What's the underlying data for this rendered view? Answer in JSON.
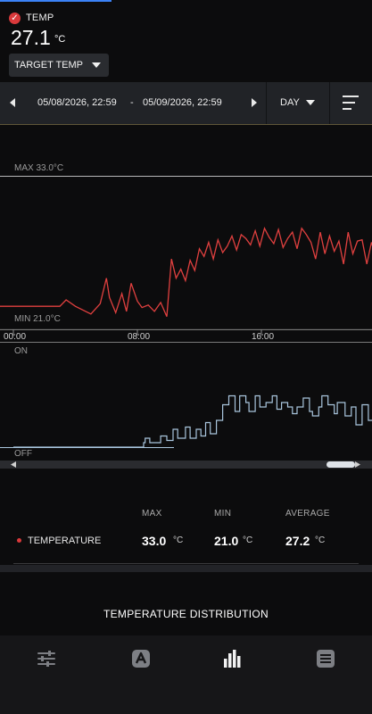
{
  "header": {
    "sensor_name": "TEMP",
    "status": "check-icon",
    "temperature": "27.1",
    "unit": "°C",
    "target_button_label": "TARGET TEMP"
  },
  "toolbar": {
    "range_start": "05/08/2026, 22:59",
    "range_separator": "-",
    "range_end": "05/09/2026, 22:59",
    "period": "DAY",
    "prev_icon": "caret-left-icon",
    "next_icon": "caret-right-icon",
    "filter_icon": "filter-lines-icon"
  },
  "chart_data": [
    {
      "type": "line",
      "x_ticks": [
        "00:00",
        "08:00",
        "16:00"
      ],
      "ylim": [
        21.0,
        33.0
      ],
      "max_label": "MAX 33.0°C",
      "min_label": "MIN 21.0°C",
      "color": "#e0403f",
      "x_hours": [
        0,
        1,
        2,
        3,
        3.4,
        4,
        5,
        5.6,
        6,
        6.2,
        6.6,
        7.0,
        7.3,
        7.6,
        8.0,
        8.3,
        8.7,
        9.1,
        9.5,
        9.9,
        10.2,
        10.5,
        10.8,
        11.1,
        11.4,
        11.7,
        12.0,
        12.3,
        12.6,
        12.9,
        13.2,
        13.5,
        13.8,
        14.1,
        14.4,
        14.7,
        15.0,
        15.3,
        15.6,
        15.9,
        16.2,
        16.5,
        16.8,
        17.1,
        17.4,
        17.7,
        18.0,
        18.3,
        18.6,
        18.9,
        19.2,
        19.5,
        19.8,
        20.1,
        20.4,
        20.7,
        21.0,
        21.3,
        21.6,
        21.9,
        22.2,
        22.5,
        22.8,
        23.1,
        23.4,
        23.7,
        24.0,
        24.2,
        24.5
      ],
      "values": [
        22.8,
        22.8,
        22.8,
        22.8,
        23.3,
        22.8,
        22.2,
        23.0,
        25.0,
        23.5,
        22.3,
        23.8,
        22.4,
        24.6,
        23.2,
        22.7,
        22.9,
        22.4,
        23.1,
        22.0,
        26.5,
        25.0,
        25.7,
        24.8,
        26.4,
        25.6,
        27.3,
        26.7,
        27.8,
        26.5,
        28.0,
        27.0,
        27.5,
        28.3,
        27.2,
        28.4,
        28.1,
        27.6,
        28.7,
        27.5,
        28.9,
        28.2,
        27.7,
        28.8,
        27.4,
        28.1,
        28.6,
        27.3,
        28.9,
        28.4,
        27.8,
        26.5,
        28.6,
        26.9,
        28.3,
        27.1,
        27.9,
        26.1,
        28.6,
        26.9,
        27.9,
        28.0,
        26.1,
        27.8,
        26.6,
        26.1,
        27.6,
        25.7,
        25.8
      ]
    },
    {
      "type": "line",
      "y_labels": [
        "ON",
        "OFF"
      ],
      "color": "#a9c5dd",
      "x_hours": [
        0,
        8.0,
        8.4,
        8.5,
        8.8,
        9.3,
        9.5,
        9.9,
        10.3,
        10.6,
        11.1,
        11.4,
        11.8,
        12.1,
        12.4,
        12.7,
        13.1,
        13.5,
        13.9,
        14.3,
        14.6,
        15.0,
        15.2,
        15.6,
        15.9,
        16.3,
        16.7,
        17.0,
        17.3,
        17.7,
        18.0,
        18.3,
        18.7,
        19.1,
        19.3,
        19.7,
        19.9,
        20.3,
        20.7,
        20.9,
        21.4,
        21.8,
        22.1,
        22.5,
        22.9,
        23.2,
        23.6,
        24.0,
        24.3
      ],
      "states": [
        0,
        0,
        0.2,
        0.4,
        0.2,
        0.2,
        0.5,
        0.3,
        0.8,
        0.4,
        0.9,
        0.4,
        0.8,
        0.5,
        1.1,
        0.6,
        1.2,
        1.9,
        2.3,
        1.6,
        2.3,
        2.0,
        1.6,
        2.3,
        1.8,
        2.0,
        2.3,
        1.7,
        2.0,
        1.8,
        1.5,
        1.8,
        2.2,
        1.6,
        1.4,
        1.8,
        2.3,
        1.9,
        1.5,
        2.0,
        1.4,
        1.8,
        1.0,
        1.9,
        1.2,
        1.4,
        1.9,
        1.2,
        1.9
      ]
    }
  ],
  "stats": {
    "headers": {
      "max": "MAX",
      "min": "MIN",
      "average": "AVERAGE"
    },
    "series_name": "TEMPERATURE",
    "max": "33.0",
    "min": "21.0",
    "average": "27.2",
    "unit": "°C"
  },
  "distribution_title": "TEMPERATURE DISTRIBUTION",
  "nav": {
    "items": [
      "sliders-icon",
      "automation-icon",
      "bar-chart-icon",
      "list-icon"
    ],
    "active": "bar-chart-icon"
  }
}
